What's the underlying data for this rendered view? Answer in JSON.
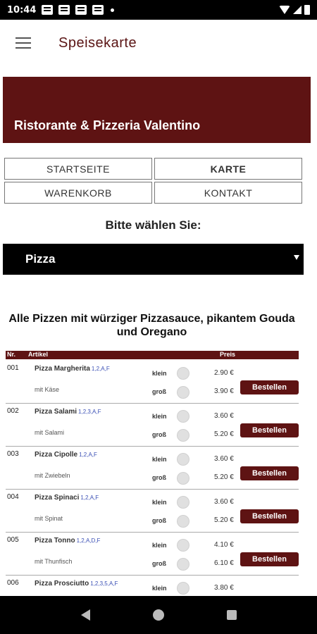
{
  "status_bar": {
    "time": "10:44"
  },
  "app_bar": {
    "title": "Speisekarte"
  },
  "banner": {
    "restaurant_name": "Ristorante & Pizzeria Valentino"
  },
  "nav": {
    "startseite": "STARTSEITE",
    "karte": "KARTE",
    "warenkorb": "WARENKORB",
    "kontakt": "KONTAKT"
  },
  "choose_label": "Bitte wählen Sie:",
  "category_select": {
    "selected": "Pizza"
  },
  "section_heading": "Alle Pizzen mit würziger Pizzasauce, pikantem Gouda und Oregano",
  "table": {
    "headers": {
      "nr": "Nr.",
      "artikel": "Artikel",
      "preis": "Preis"
    },
    "size_small": "klein",
    "size_large": "groß",
    "order_label": "Bestellen",
    "items": [
      {
        "nr": "001",
        "name": "Pizza Margherita",
        "additives": "1,2,A,F",
        "sub": "mit Käse",
        "price_small": "2.90 €",
        "price_large": "3.90 €"
      },
      {
        "nr": "002",
        "name": "Pizza Salami",
        "additives": "1,2,3,A,F",
        "sub": "mit Salami",
        "price_small": "3.60 €",
        "price_large": "5.20 €"
      },
      {
        "nr": "003",
        "name": "Pizza Cipolle",
        "additives": "1,2,A,F",
        "sub": "mit Zwiebeln",
        "price_small": "3.60 €",
        "price_large": "5.20 €"
      },
      {
        "nr": "004",
        "name": "Pizza Spinaci",
        "additives": "1,2,A,F",
        "sub": "mit Spinat",
        "price_small": "3.60 €",
        "price_large": "5.20 €"
      },
      {
        "nr": "005",
        "name": "Pizza Tonno",
        "additives": "1,2,A,D,F",
        "sub": "mit Thunfisch",
        "price_small": "4.10 €",
        "price_large": "6.10 €"
      },
      {
        "nr": "006",
        "name": "Pizza Prosciutto",
        "additives": "1,2,3,5,A,F",
        "sub": "",
        "price_small": "3.80 €",
        "price_large": ""
      }
    ]
  }
}
